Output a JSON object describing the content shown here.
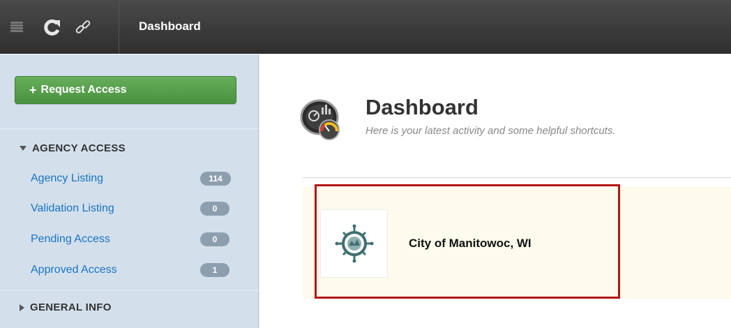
{
  "topbar": {
    "title": "Dashboard",
    "icons": [
      "menu-icon",
      "refresh-icon",
      "link-icon"
    ]
  },
  "sidebar": {
    "request_button": {
      "icon": "plus-icon",
      "label": "Request Access"
    },
    "sections": [
      {
        "title": "AGENCY ACCESS",
        "expanded": true,
        "items": [
          {
            "label": "Agency Listing",
            "count": "114"
          },
          {
            "label": "Validation Listing",
            "count": "0"
          },
          {
            "label": "Pending Access",
            "count": "0"
          },
          {
            "label": "Approved Access",
            "count": "1"
          }
        ]
      },
      {
        "title": "GENERAL INFO",
        "expanded": false
      }
    ]
  },
  "main": {
    "icon": "dashboard-gauge-icon",
    "title": "Dashboard",
    "subtitle": "Here is your latest activity and some helpful shortcuts.",
    "agency_card": {
      "logo": "city-of-manitowoc-seal",
      "name": "City of Manitowoc, WI",
      "highlighted": true
    }
  },
  "colors": {
    "topbar": "#3a3a3a",
    "sidebar": "#d3e0ec",
    "accent_green": "#55a049",
    "link_blue": "#1a73c4",
    "badge": "#8d9eae",
    "card_bg": "#fcfbec",
    "highlight_border": "#b41414"
  }
}
